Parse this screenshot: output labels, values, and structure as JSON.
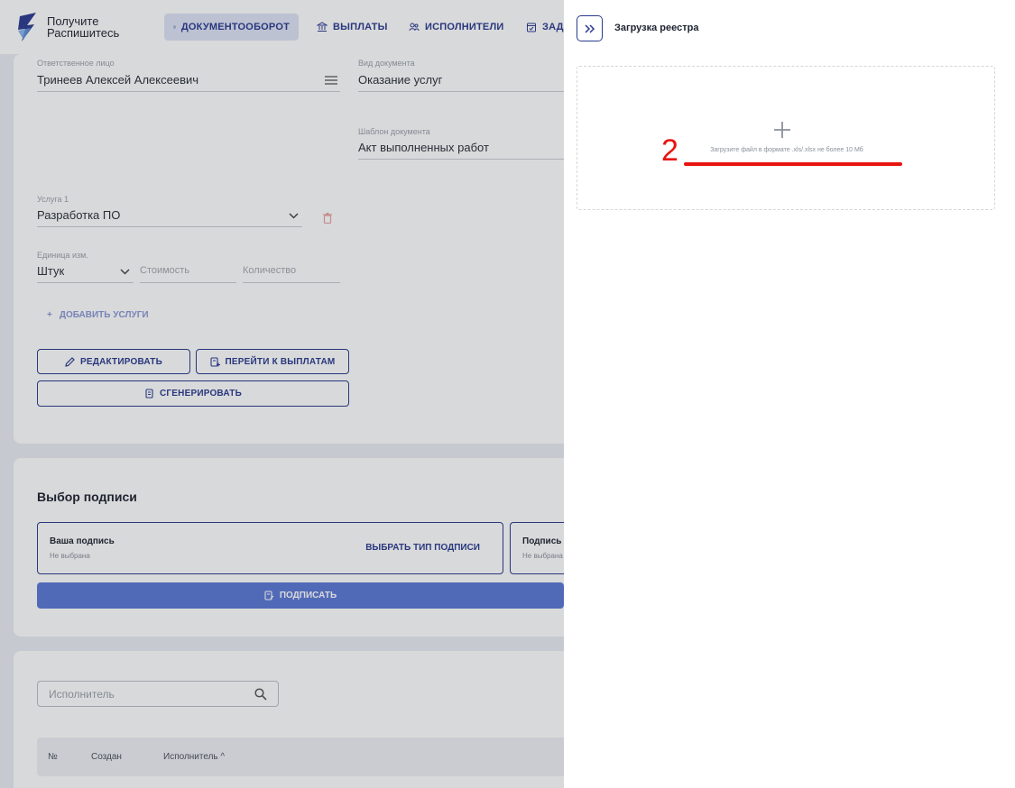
{
  "header": {
    "brand_line1": "Получите",
    "brand_line2": "Распишитесь",
    "nav": [
      {
        "label": "ДОКУМЕНТООБОРОТ",
        "icon": "document-icon",
        "active": true
      },
      {
        "label": "ВЫПЛАТЫ",
        "icon": "bank-icon"
      },
      {
        "label": "ИСПОЛНИТЕЛИ",
        "icon": "users-icon"
      },
      {
        "label": "ЗАДА",
        "icon": "calendar-icon"
      }
    ]
  },
  "form": {
    "responsible_label": "Ответственное лицо",
    "responsible_value": "Тринеев Алексей Алексеевич",
    "doc_type_label": "Вид документа",
    "doc_type_value": "Оказание услуг",
    "template_label": "Шаблон документа",
    "template_value": "Акт выполненных работ",
    "service_label": "Услуга 1",
    "service_value": "Разработка ПО",
    "unit_label": "Единица изм.",
    "unit_value": "Штук",
    "cost_placeholder": "Стоимость",
    "qty_placeholder": "Количество",
    "add_services": "ДОБАВИТЬ УСЛУГИ",
    "edit_button": "РЕДАКТИРОВАТЬ",
    "to_payments_button": "ПЕРЕЙТИ К ВЫПЛАТАМ",
    "generate_button": "СГЕНЕРИРОВАТЬ"
  },
  "signature": {
    "title": "Выбор подписи",
    "your_sig_title": "Ваша подпись",
    "your_sig_status": "Не выбрана",
    "choose_type": "ВЫБРАТЬ ТИП ПОДПИСИ",
    "other_sig_title": "Подпись",
    "other_sig_status": "Не выбрана",
    "sign_button": "ПОДПИСАТЬ"
  },
  "table": {
    "search_placeholder": "Исполнитель",
    "columns": [
      "№",
      "Создан",
      "Исполнитель"
    ]
  },
  "panel": {
    "title": "Загрузка реестра",
    "hint": "Загрузите файл в формате .xls/.xlsx не более 10 Мб",
    "annotation_number": "2"
  },
  "colors": {
    "accent": "#2a3a8f",
    "sign_button": "#5b78d6",
    "annotation": "#e8140f"
  }
}
